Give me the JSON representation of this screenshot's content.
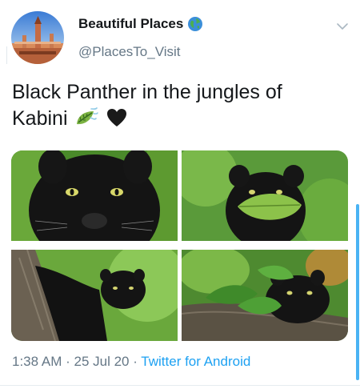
{
  "author": {
    "name": "Beautiful Places",
    "handle": "@PlacesTo_Visit",
    "verified_icon": "globe-icon",
    "avatar_icon": "cityscape-avatar"
  },
  "tweet": {
    "text_line1": "Black Panther in the jungles of",
    "text_line2": "Kabini",
    "emoji": [
      "leaf-fluttering-in-wind-emoji",
      "black-heart-emoji"
    ]
  },
  "media": {
    "photos": [
      {
        "name": "panther-face-closeup"
      },
      {
        "name": "panther-behind-leaf"
      },
      {
        "name": "panther-on-tree-trunk"
      },
      {
        "name": "panther-with-leaves-on-branch"
      }
    ]
  },
  "meta": {
    "time": "1:38 AM",
    "separator1": " · ",
    "date": "25 Jul 20",
    "separator2": " · ",
    "source": "Twitter for Android"
  },
  "colors": {
    "text": "#14171a",
    "secondary": "#657786",
    "link": "#1da1f2"
  }
}
